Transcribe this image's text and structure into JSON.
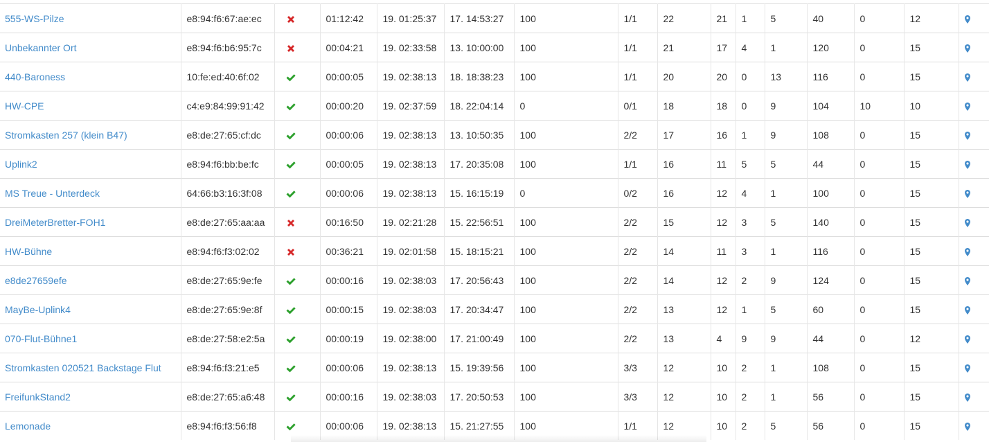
{
  "accent_color": "#428bca",
  "status_colors": {
    "online": "#2ca02c",
    "offline": "#d62728"
  },
  "icons": {
    "online": "check-icon",
    "offline": "cross-icon",
    "location": "map-marker-icon"
  },
  "rows": [
    {
      "name": "555-WS-Pilze",
      "mac": "e8:94:f6:67:ae:ec",
      "online": false,
      "uptime": "01:12:42",
      "last_seen": "19. 01:25:37",
      "first_seen": "17. 14:53:27",
      "c1": "100",
      "c2": "1/1",
      "c3": "22",
      "c4": "21",
      "c5": "1",
      "c6": "5",
      "c7": "40",
      "c8": "0",
      "c9": "12"
    },
    {
      "name": "Unbekannter Ort",
      "mac": "e8:94:f6:b6:95:7c",
      "online": false,
      "uptime": "00:04:21",
      "last_seen": "19. 02:33:58",
      "first_seen": "13. 10:00:00",
      "c1": "100",
      "c2": "1/1",
      "c3": "21",
      "c4": "17",
      "c5": "4",
      "c6": "1",
      "c7": "120",
      "c8": "0",
      "c9": "15"
    },
    {
      "name": "440-Baroness",
      "mac": "10:fe:ed:40:6f:02",
      "online": true,
      "uptime": "00:00:05",
      "last_seen": "19. 02:38:13",
      "first_seen": "18. 18:38:23",
      "c1": "100",
      "c2": "1/1",
      "c3": "20",
      "c4": "20",
      "c5": "0",
      "c6": "13",
      "c7": "116",
      "c8": "0",
      "c9": "15"
    },
    {
      "name": "HW-CPE",
      "mac": "c4:e9:84:99:91:42",
      "online": true,
      "uptime": "00:00:20",
      "last_seen": "19. 02:37:59",
      "first_seen": "18. 22:04:14",
      "c1": "0",
      "c2": "0/1",
      "c3": "18",
      "c4": "18",
      "c5": "0",
      "c6": "9",
      "c7": "104",
      "c8": "10",
      "c9": "10"
    },
    {
      "name": "Stromkasten 257 (klein B47)",
      "mac": "e8:de:27:65:cf:dc",
      "online": true,
      "uptime": "00:00:06",
      "last_seen": "19. 02:38:13",
      "first_seen": "13. 10:50:35",
      "c1": "100",
      "c2": "2/2",
      "c3": "17",
      "c4": "16",
      "c5": "1",
      "c6": "9",
      "c7": "108",
      "c8": "0",
      "c9": "15"
    },
    {
      "name": "Uplink2",
      "mac": "e8:94:f6:bb:be:fc",
      "online": true,
      "uptime": "00:00:05",
      "last_seen": "19. 02:38:13",
      "first_seen": "17. 20:35:08",
      "c1": "100",
      "c2": "1/1",
      "c3": "16",
      "c4": "11",
      "c5": "5",
      "c6": "5",
      "c7": "44",
      "c8": "0",
      "c9": "15"
    },
    {
      "name": "MS Treue - Unterdeck",
      "mac": "64:66:b3:16:3f:08",
      "online": true,
      "uptime": "00:00:06",
      "last_seen": "19. 02:38:13",
      "first_seen": "15. 16:15:19",
      "c1": "0",
      "c2": "0/2",
      "c3": "16",
      "c4": "12",
      "c5": "4",
      "c6": "1",
      "c7": "100",
      "c8": "0",
      "c9": "15"
    },
    {
      "name": "DreiMeterBretter-FOH1",
      "mac": "e8:de:27:65:aa:aa",
      "online": false,
      "uptime": "00:16:50",
      "last_seen": "19. 02:21:28",
      "first_seen": "15. 22:56:51",
      "c1": "100",
      "c2": "2/2",
      "c3": "15",
      "c4": "12",
      "c5": "3",
      "c6": "5",
      "c7": "140",
      "c8": "0",
      "c9": "15"
    },
    {
      "name": "HW-Bühne",
      "mac": "e8:94:f6:f3:02:02",
      "online": false,
      "uptime": "00:36:21",
      "last_seen": "19. 02:01:58",
      "first_seen": "15. 18:15:21",
      "c1": "100",
      "c2": "2/2",
      "c3": "14",
      "c4": "11",
      "c5": "3",
      "c6": "1",
      "c7": "116",
      "c8": "0",
      "c9": "15"
    },
    {
      "name": "e8de27659efe",
      "mac": "e8:de:27:65:9e:fe",
      "online": true,
      "uptime": "00:00:16",
      "last_seen": "19. 02:38:03",
      "first_seen": "17. 20:56:43",
      "c1": "100",
      "c2": "2/2",
      "c3": "14",
      "c4": "12",
      "c5": "2",
      "c6": "9",
      "c7": "124",
      "c8": "0",
      "c9": "15"
    },
    {
      "name": "MayBe-Uplink4",
      "mac": "e8:de:27:65:9e:8f",
      "online": true,
      "uptime": "00:00:15",
      "last_seen": "19. 02:38:03",
      "first_seen": "17. 20:34:47",
      "c1": "100",
      "c2": "2/2",
      "c3": "13",
      "c4": "12",
      "c5": "1",
      "c6": "5",
      "c7": "60",
      "c8": "0",
      "c9": "15"
    },
    {
      "name": "070-Flut-Bühne1",
      "mac": "e8:de:27:58:e2:5a",
      "online": true,
      "uptime": "00:00:19",
      "last_seen": "19. 02:38:00",
      "first_seen": "17. 21:00:49",
      "c1": "100",
      "c2": "2/2",
      "c3": "13",
      "c4": "4",
      "c5": "9",
      "c6": "9",
      "c7": "44",
      "c8": "0",
      "c9": "12"
    },
    {
      "name": "Stromkasten 020521 Backstage Flut",
      "mac": "e8:94:f6:f3:21:e5",
      "online": true,
      "uptime": "00:00:06",
      "last_seen": "19. 02:38:13",
      "first_seen": "15. 19:39:56",
      "c1": "100",
      "c2": "3/3",
      "c3": "12",
      "c4": "10",
      "c5": "2",
      "c6": "1",
      "c7": "108",
      "c8": "0",
      "c9": "15"
    },
    {
      "name": "FreifunkStand2",
      "mac": "e8:de:27:65:a6:48",
      "online": true,
      "uptime": "00:00:16",
      "last_seen": "19. 02:38:03",
      "first_seen": "17. 20:50:53",
      "c1": "100",
      "c2": "3/3",
      "c3": "12",
      "c4": "10",
      "c5": "2",
      "c6": "1",
      "c7": "56",
      "c8": "0",
      "c9": "15"
    },
    {
      "name": "Lemonade",
      "mac": "e8:94:f6:f3:56:f8",
      "online": true,
      "uptime": "00:00:06",
      "last_seen": "19. 02:38:13",
      "first_seen": "15. 21:27:55",
      "c1": "100",
      "c2": "1/1",
      "c3": "12",
      "c4": "10",
      "c5": "2",
      "c6": "5",
      "c7": "56",
      "c8": "0",
      "c9": "15"
    }
  ]
}
